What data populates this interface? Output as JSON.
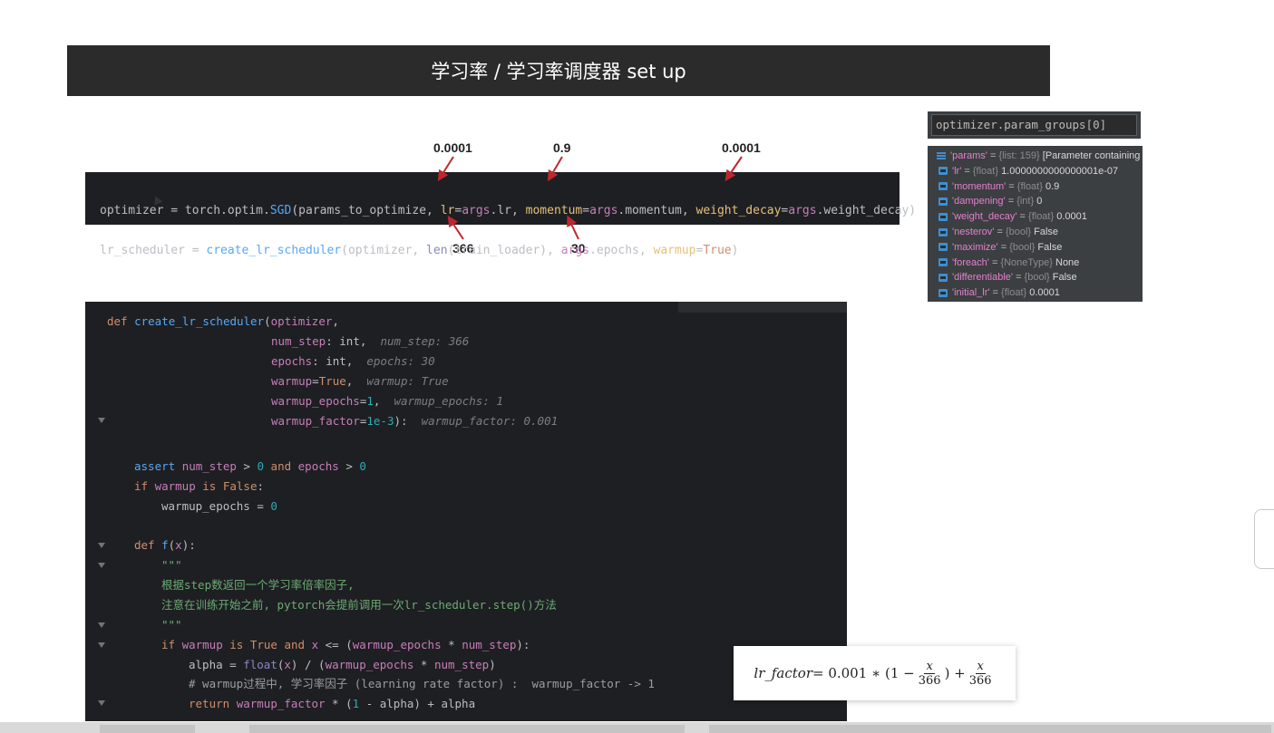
{
  "slide_title": "学习率 / 学习率调度器 set up",
  "annotations": {
    "lr": "0.0001",
    "momentum": "0.9",
    "weight_decay": "0.0001",
    "num_step": "366",
    "epochs": "30"
  },
  "code_top": {
    "line1": {
      "a": "optimizer = torch.optim.",
      "b": "SGD",
      "c": "(params_to_optimize, ",
      "d": "lr",
      "e": "=",
      "f": "args",
      "g": ".lr, ",
      "h": "momentum",
      "i": "=",
      "j": "args",
      "k": ".momentum, ",
      "l": "weight_decay",
      "m": "=",
      "n": "args",
      "o": ".weight_decay)"
    },
    "line2": {
      "a": "lr_scheduler = ",
      "b": "create_lr_scheduler",
      "c": "(optimizer, ",
      "d": "len",
      "e": "(train_loader), ",
      "f": "args",
      "g": ".epochs, ",
      "h": "warmup",
      "i": "=",
      "j": "True",
      "k": ")"
    }
  },
  "code_main": {
    "l1": {
      "kw": "def ",
      "fn": "create_lr_scheduler",
      "rest": "(",
      "p": "optimizer",
      "end": ","
    },
    "l2": {
      "p": "num_step",
      "rest": ": int,",
      "hint": "num_step: 366"
    },
    "l3": {
      "p": "epochs",
      "rest": ": int,",
      "hint": "epochs: 30"
    },
    "l4": {
      "p": "warmup",
      "eq": "=",
      "val": "True",
      "end": ",",
      "hint": "warmup: True"
    },
    "l5": {
      "p": "warmup_epochs",
      "eq": "=",
      "val": "1",
      "end": ",",
      "hint": "warmup_epochs: 1"
    },
    "l6": {
      "p": "warmup_factor",
      "eq": "=",
      "val": "1e-3",
      "end": "):",
      "hint": "warmup_factor: 0.001"
    },
    "l7": {
      "kw": "assert ",
      "a": "num_step",
      "b": " > ",
      "c": "0",
      "d": " and ",
      "e": "epochs",
      "f": " > ",
      "g": "0"
    },
    "l8": {
      "kw": "if ",
      "a": "warmup",
      "b": " is ",
      "c": "False",
      "d": ":"
    },
    "l9": {
      "a": "warmup_epochs = ",
      "b": "0"
    },
    "l10": {
      "kw": "def ",
      "fn": "f",
      "rest": "(",
      "p": "x",
      "end": "):"
    },
    "l11": "\"\"\"",
    "l12": "根据step数返回一个学习率倍率因子,",
    "l13": "注意在训练开始之前, pytorch会提前调用一次lr_scheduler.step()方法",
    "l14": "\"\"\"",
    "l15": {
      "kw": "if ",
      "a": "warmup",
      "b": " is ",
      "c": "True",
      "d": " and ",
      "e": "x",
      "f": " <= (",
      "g": "warmup_epochs",
      "h": " * ",
      "i": "num_step",
      "j": "):"
    },
    "l16": {
      "a": "alpha = ",
      "b": "float",
      "c": "(",
      "d": "x",
      "e": ") / (",
      "f": "warmup_epochs",
      "g": " * ",
      "h": "num_step",
      "i": ")"
    },
    "l17": "# warmup过程中, 学习率因子 (learning rate factor) :  warmup_factor -> 1",
    "l18": {
      "kw": "return ",
      "a": "warmup_factor",
      "b": " * (",
      "c": "1",
      "d": " - alpha) + alpha"
    }
  },
  "debugger": {
    "expression": "optimizer.param_groups[0]",
    "items": [
      {
        "key": "'params'",
        "type": "{list: 159}",
        "value": "[Parameter containing"
      },
      {
        "key": "'lr'",
        "type": "{float}",
        "value": "1.0000000000000001e-07"
      },
      {
        "key": "'momentum'",
        "type": "{float}",
        "value": "0.9"
      },
      {
        "key": "'dampening'",
        "type": "{int}",
        "value": "0"
      },
      {
        "key": "'weight_decay'",
        "type": "{float}",
        "value": "0.0001"
      },
      {
        "key": "'nesterov'",
        "type": "{bool}",
        "value": "False"
      },
      {
        "key": "'maximize'",
        "type": "{bool}",
        "value": "False"
      },
      {
        "key": "'foreach'",
        "type": "{NoneType}",
        "value": "None"
      },
      {
        "key": "'differentiable'",
        "type": "{bool}",
        "value": "False"
      },
      {
        "key": "'initial_lr'",
        "type": "{float}",
        "value": "0.0001"
      }
    ]
  },
  "formula": {
    "lhs": "lr_factor",
    "eq": " = 0.001 ∗ (1 − ",
    "x": "x",
    "den": "366",
    "mid": ") + ",
    "x2": "x",
    "den2": "366"
  }
}
